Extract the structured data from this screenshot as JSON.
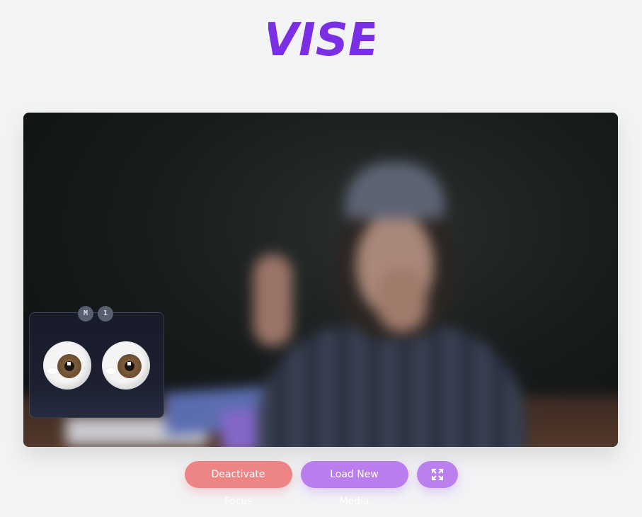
{
  "brand": {
    "logo_text": "VISE",
    "color": "#7b2fe4"
  },
  "media": {
    "content": "blurred video frame of a person at a desk"
  },
  "eye_overlay": {
    "chips": [
      "M",
      "1"
    ],
    "eyes": [
      "left-eye",
      "right-eye"
    ]
  },
  "controls": {
    "deactivate_label": "Deactivate Focus",
    "deactivate_color": "#ee8585",
    "load_label": "Load New Media",
    "load_color": "#b97ded",
    "fullscreen_icon": "expand-icon"
  }
}
